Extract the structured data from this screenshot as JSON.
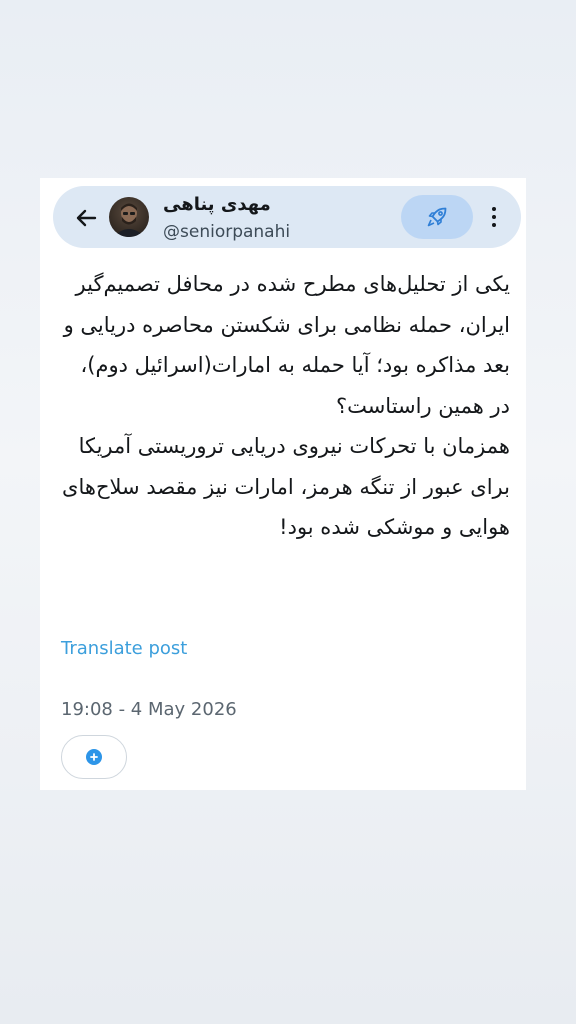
{
  "profile": {
    "display_name": "مهدی پناهی",
    "handle": "@seniorpanahi"
  },
  "post": {
    "paragraphs": [
      "یکی از تحلیل‌های مطرح شده در محافل تصمیم‌گیر ایران، حمله نظامی برای شکستن محاصره دریایی و بعد مذاکره بود؛ آیا حمله به امارات(اسرائیل دوم)، در همین راستاست؟",
      "همزمان با تحرکات نیروی دریایی تروریستی آمریکا برای عبور از تنگه هرمز، امارات نیز مقصد سلاح‌های هوایی و موشکی شده بود!"
    ],
    "translate_label": "Translate post",
    "timestamp": "19:08 - 4 May 2026"
  },
  "icons": {
    "back": "arrow-left-icon",
    "boost": "rocket-icon",
    "more": "more-vertical-icon",
    "reply": "add-reply-icon"
  },
  "colors": {
    "link": "#3c9fdc",
    "header_bg": "#dde8f4",
    "boost_bg": "#bcd6f4",
    "reply_dot": "#2d95e8"
  }
}
